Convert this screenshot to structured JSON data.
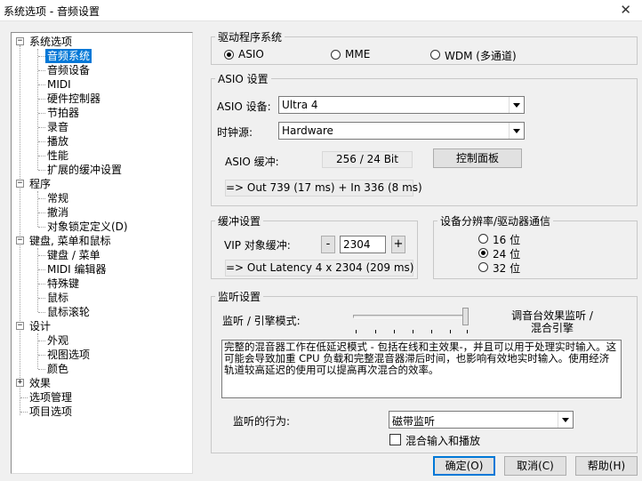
{
  "window": {
    "title": "系统选项 - 音频设置",
    "close_glyph": "✕"
  },
  "tree": {
    "collapse_glyph": "−",
    "expand_glyph": "+",
    "items": [
      {
        "label": "系统选项"
      },
      {
        "label": "音频系统"
      },
      {
        "label": "音频设备"
      },
      {
        "label": "MIDI"
      },
      {
        "label": "硬件控制器"
      },
      {
        "label": "节拍器"
      },
      {
        "label": "录音"
      },
      {
        "label": "播放"
      },
      {
        "label": "性能"
      },
      {
        "label": "扩展的缓冲设置"
      },
      {
        "label": "程序"
      },
      {
        "label": "常规"
      },
      {
        "label": "撤消"
      },
      {
        "label": "对象锁定定义(D)"
      },
      {
        "label": "键盘, 菜单和鼠标"
      },
      {
        "label": "键盘 / 菜单"
      },
      {
        "label": "MIDI 编辑器"
      },
      {
        "label": "特殊键"
      },
      {
        "label": "鼠标"
      },
      {
        "label": "鼠标滚轮"
      },
      {
        "label": "设计"
      },
      {
        "label": "外观"
      },
      {
        "label": "视图选项"
      },
      {
        "label": "颜色"
      },
      {
        "label": "效果"
      },
      {
        "label": "选项管理"
      },
      {
        "label": "项目选项"
      }
    ]
  },
  "driver": {
    "legend": "驱动程序系统",
    "options": [
      "ASIO",
      "MME",
      "WDM (多通道)"
    ],
    "selected": "ASIO"
  },
  "asio": {
    "legend": "ASIO 设置",
    "device_label": "ASIO 设备:",
    "device_value": "Ultra 4",
    "clock_label": "时钟源:",
    "clock_value": "Hardware",
    "buffer_label": "ASIO 缓冲:",
    "buffer_value": "256 / 24 Bit",
    "control_panel_label": "控制面板",
    "latency": "=> Out 739 (17 ms) + In 336 (8 ms)"
  },
  "buffer": {
    "legend": "缓冲设置",
    "vip_label": "VIP 对象缓冲:",
    "minus": "-",
    "value": "2304",
    "plus": "+",
    "latency": "=> Out Latency 4 x 2304 (209 ms)"
  },
  "resolution": {
    "legend": "设备分辨率/驱动器通信",
    "options": [
      "16 位",
      "24 位",
      "32 位"
    ],
    "selected": "24 位"
  },
  "monitor": {
    "legend": "监听设置",
    "mode_label": "监听 / 引擎模式:",
    "right_label_1": "调音台效果监听 /",
    "right_label_2": "混合引擎",
    "slider_value": 1.0,
    "description": "完整的混音器工作在低延迟模式 - 包括在线和主效果-，并且可以用于处理实时输入。这可能会导致加重 CPU 负载和完整混音器滞后时间，也影响有效地实时输入。使用经济轨道较高延迟的使用可以提高再次混合的效率。",
    "behavior_label": "监听的行为:",
    "behavior_value": "磁带监听",
    "mix_label": "混合输入和播放",
    "mix_checked": false
  },
  "buttons": {
    "ok": "确定(O)",
    "cancel": "取消(C)",
    "help": "帮助(H)"
  }
}
